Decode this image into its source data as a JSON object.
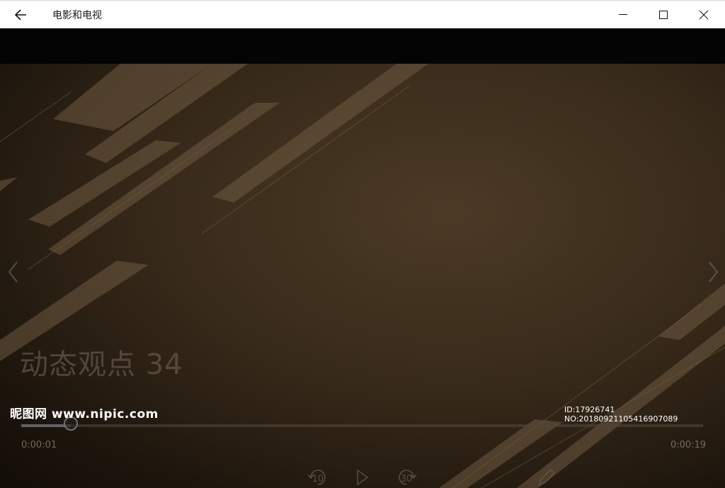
{
  "window": {
    "title": "电影和电视",
    "back_icon": "arrow-left-icon",
    "minimize_icon": "minimize-icon",
    "maximize_icon": "maximize-icon",
    "close_icon": "close-icon"
  },
  "video": {
    "overlay_title": "动态观点 34",
    "progress_fraction": 0.073,
    "elapsed": "0:00:01",
    "total": "0:00:19"
  },
  "controls": {
    "rewind_label": "10",
    "forward_label": "30",
    "play_icon": "play-icon",
    "rewind_icon": "rewind-10-icon",
    "forward_icon": "forward-30-icon",
    "edit_icon": "pencil-icon"
  },
  "watermark": {
    "left": "昵图网 www.nipic.com",
    "right": "ID:17926741 NO:20180921105416907089"
  },
  "colors": {
    "titlebar_bg": "#ffffff",
    "video_bg": "#382a1a",
    "stripe": "#6e5a42"
  }
}
